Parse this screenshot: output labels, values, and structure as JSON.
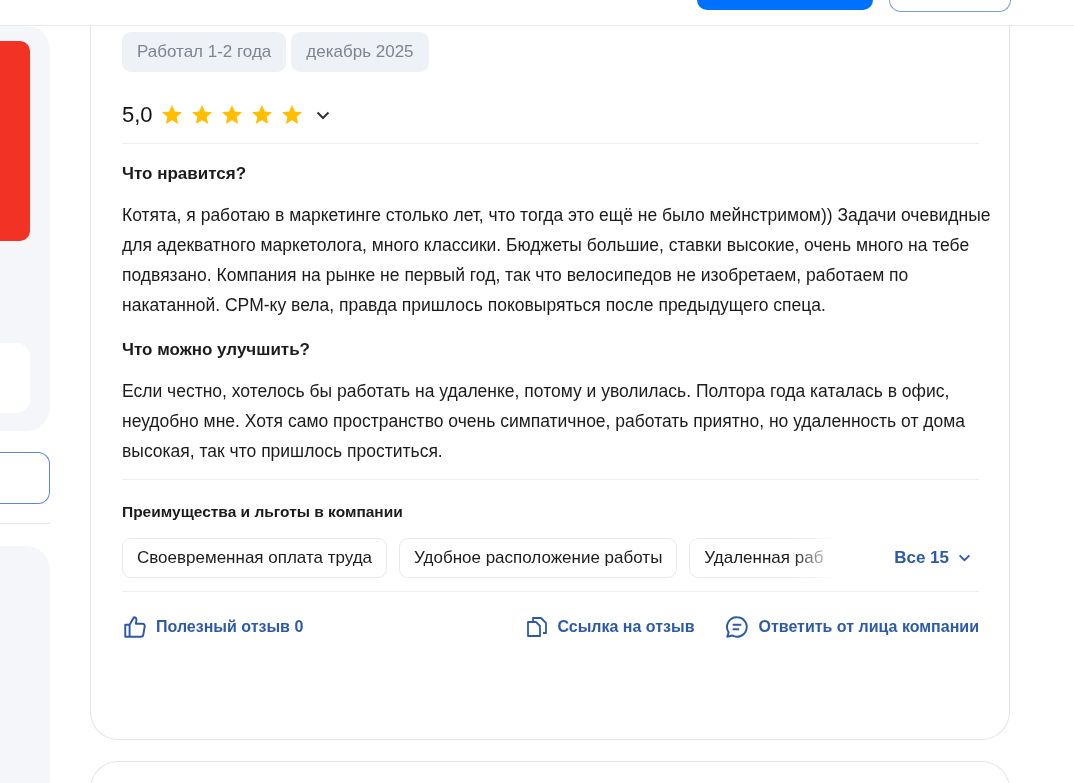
{
  "review": {
    "tags": [
      "Работал 1-2 года",
      "декабрь 2025"
    ],
    "rating": "5,0",
    "stars": 5,
    "sections": [
      {
        "title": "Что нравится?",
        "text": "Котята, я работаю в маркетинге столько лет, что тогда это ещё не было мейнстримом)) Задачи очевидные для адекватного маркетолога, много классики. Бюджеты большие, ставки высокие, очень много на тебе подвязано. Компания на рынке не первый год, так что велосипедов не изобретаем, работаем по накатанной. CPM-ку вела, правда пришлось поковыряться после предыдущего спеца."
      },
      {
        "title": "Что можно улучшить?",
        "text": "Если честно, хотелось бы работать на удаленке, потому и уволилась. Полтора года каталась в офис, неудобно мне. Хотя само пространство очень симпатичное, работать приятно, но удаленность от дома высокая, так что пришлось проститься."
      }
    ],
    "benefits_title": "Преимущества и льготы в компании",
    "benefits": [
      "Своевременная оплата труда",
      "Удобное расположение работы",
      "Удаленная раб"
    ],
    "benefits_more": "Все 15",
    "actions": [
      {
        "kind": "like",
        "label": "Полезный отзыв 0"
      },
      {
        "kind": "link",
        "label": "Ссылка на отзыв"
      },
      {
        "kind": "reply",
        "label": "Ответить от лица компании"
      }
    ]
  }
}
